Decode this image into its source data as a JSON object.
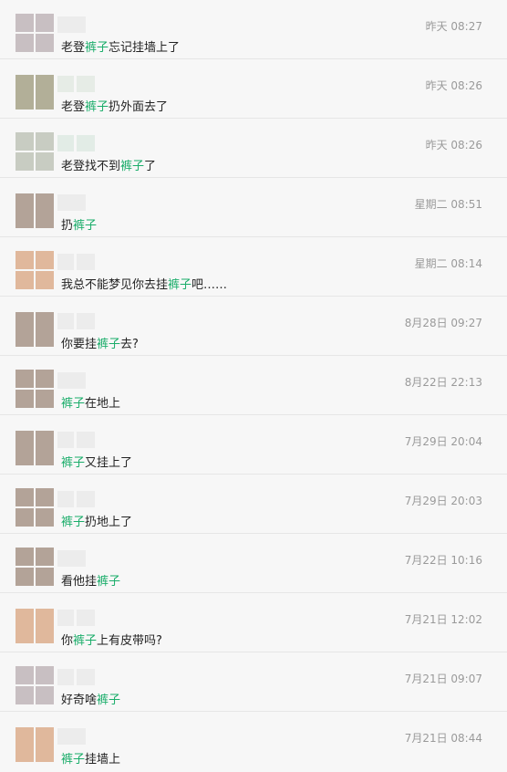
{
  "conversations": [
    {
      "time": "昨天 08:27",
      "pre": "老登",
      "hl": "裤子",
      "post": "忘记挂墙上了",
      "avatar": "c8bfc2",
      "nameColor": "ececec",
      "layout": "grid"
    },
    {
      "time": "昨天 08:26",
      "pre": "老登",
      "hl": "裤子",
      "post": "扔外面去了",
      "avatar": "b2af98",
      "nameColor": "e6ece6",
      "layout": "cols"
    },
    {
      "time": "昨天 08:26",
      "pre": "老登找不到",
      "hl": "裤子",
      "post": "了",
      "avatar": "c8ccc2",
      "nameColor": "e2ece6",
      "layout": "grid"
    },
    {
      "time": "星期二 08:51",
      "pre": "扔",
      "hl": "裤子",
      "post": "",
      "avatar": "b3a398",
      "nameColor": "ececec",
      "layout": "cols"
    },
    {
      "time": "星期二 08:14",
      "pre": "我总不能梦见你去挂",
      "hl": "裤子",
      "post": "吧……",
      "avatar": "e0b89c",
      "nameColor": "ececec",
      "layout": "grid"
    },
    {
      "time": "8月28日 09:27",
      "pre": "你要挂",
      "hl": "裤子",
      "post": "去?",
      "avatar": "b3a398",
      "nameColor": "ececec",
      "layout": "cols"
    },
    {
      "time": "8月22日 22:13",
      "pre": "",
      "hl": "裤子",
      "post": "在地上",
      "avatar": "b3a398",
      "nameColor": "ececec",
      "layout": "grid"
    },
    {
      "time": "7月29日 20:04",
      "pre": "",
      "hl": "裤子",
      "post": "又挂上了",
      "avatar": "b3a398",
      "nameColor": "ececec",
      "layout": "cols"
    },
    {
      "time": "7月29日 20:03",
      "pre": "",
      "hl": "裤子",
      "post": "扔地上了",
      "avatar": "b3a398",
      "nameColor": "ececec",
      "layout": "grid"
    },
    {
      "time": "7月22日 10:16",
      "pre": "看他挂",
      "hl": "裤子",
      "post": "",
      "avatar": "b3a398",
      "nameColor": "ececec",
      "layout": "grid"
    },
    {
      "time": "7月21日 12:02",
      "pre": "你",
      "hl": "裤子",
      "post": "上有皮带吗?",
      "avatar": "e0b89c",
      "nameColor": "ececec",
      "layout": "cols"
    },
    {
      "time": "7月21日 09:07",
      "pre": "好奇啥",
      "hl": "裤子",
      "post": "",
      "avatar": "c8bfc2",
      "nameColor": "ececec",
      "layout": "grid"
    },
    {
      "time": "7月21日 08:44",
      "pre": "",
      "hl": "裤子",
      "post": "挂墙上",
      "avatar": "e0b89c",
      "nameColor": "ececec",
      "layout": "cols"
    }
  ]
}
